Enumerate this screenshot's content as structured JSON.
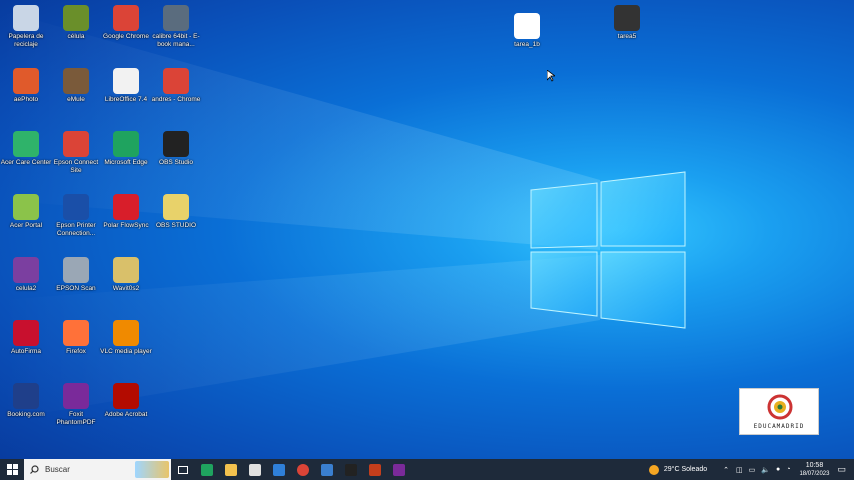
{
  "desktop": {
    "icons": [
      {
        "label": "Papelera de reciclaje",
        "icon": "recycle-bin-icon",
        "color": "#c9d6e6"
      },
      {
        "label": "célula",
        "icon": "celula-icon",
        "color": "#6a8f2a"
      },
      {
        "label": "Google Chrome",
        "icon": "chrome-icon",
        "color": "#db4437"
      },
      {
        "label": "calibre 64bit - E-book mana...",
        "icon": "calibre-icon",
        "color": "#5a6c7e"
      },
      {
        "label": "aePhoto",
        "icon": "aephoto-icon",
        "color": "#e05a2b"
      },
      {
        "label": "eMule",
        "icon": "emule-icon",
        "color": "#7a5a3a"
      },
      {
        "label": "LibreOffice 7.4",
        "icon": "libreoffice-icon",
        "color": "#f2f2f2"
      },
      {
        "label": "andres - Chrome",
        "icon": "chrome-profile-icon",
        "color": "#db4437"
      },
      {
        "label": "Acer Care Center",
        "icon": "acer-care-center-icon",
        "color": "#2fb36a"
      },
      {
        "label": "Epson Connect Site",
        "icon": "epson-connect-icon",
        "color": "#db4437"
      },
      {
        "label": "Microsoft Edge",
        "icon": "edge-icon",
        "color": "#1fa35f"
      },
      {
        "label": "OBS Studio",
        "icon": "obs-icon",
        "color": "#222222"
      },
      {
        "label": "Acer Portal",
        "icon": "acer-portal-icon",
        "color": "#8bc34a"
      },
      {
        "label": "Epson Printer Connection...",
        "icon": "epson-printer-icon",
        "color": "#1a4fa8"
      },
      {
        "label": "Polar FlowSync",
        "icon": "polar-icon",
        "color": "#d81e2a"
      },
      {
        "label": "OBS STUDIO",
        "icon": "obs-shortcut-icon",
        "color": "#e8d26a"
      },
      {
        "label": "celula2",
        "icon": "winrar-icon",
        "color": "#7b3fa0"
      },
      {
        "label": "EPSON Scan",
        "icon": "epson-scan-icon",
        "color": "#9aa7b5"
      },
      {
        "label": "Wavit0s2",
        "icon": "wavit-icon",
        "color": "#d9c06a"
      },
      {
        "label": "AutoFirma",
        "icon": "autofirma-icon",
        "color": "#c8102e"
      },
      {
        "label": "Firefox",
        "icon": "firefox-icon",
        "color": "#ff7139"
      },
      {
        "label": "VLC media player",
        "icon": "vlc-icon",
        "color": "#f08a00"
      },
      {
        "label": "Booking.com",
        "icon": "booking-icon",
        "color": "#1f3f8a"
      },
      {
        "label": "Foxit PhantomPDF",
        "icon": "foxit-icon",
        "color": "#7a2a9a"
      },
      {
        "label": "Adobe Acrobat",
        "icon": "acrobat-icon",
        "color": "#b30b00"
      },
      {
        "label": "tarea_1b",
        "icon": "tarea1b-file-icon",
        "color": "#ffffff"
      },
      {
        "label": "tarea5",
        "icon": "tarea5-video-icon",
        "color": "#333333"
      }
    ],
    "logo": {
      "text": "EDUCAMADRID"
    }
  },
  "taskbar": {
    "search_placeholder": "Buscar",
    "pinned": [
      {
        "icon": "task-view-icon"
      },
      {
        "icon": "edge-taskbar-icon"
      },
      {
        "icon": "file-explorer-icon"
      },
      {
        "icon": "store-icon"
      },
      {
        "icon": "mail-icon"
      },
      {
        "icon": "chrome-taskbar-icon"
      },
      {
        "icon": "photos-icon"
      },
      {
        "icon": "obs-taskbar-icon"
      },
      {
        "icon": "powerpoint-icon"
      },
      {
        "icon": "foxit-taskbar-icon"
      }
    ],
    "weather": "29°C  Soleado",
    "time": "10:58",
    "date": "18/07/2023"
  }
}
